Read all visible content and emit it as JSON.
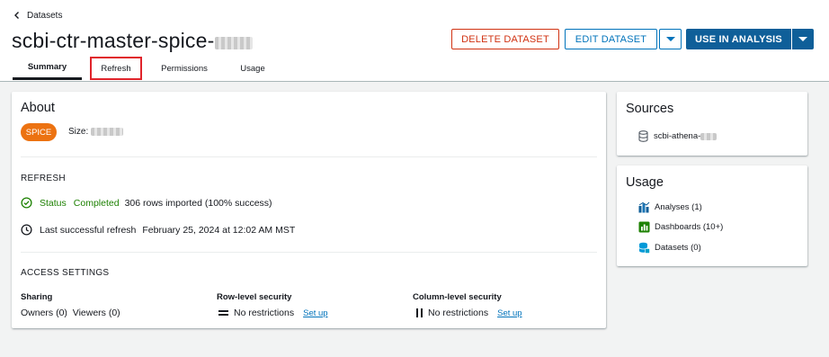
{
  "breadcrumb": {
    "back_label": "Datasets"
  },
  "header": {
    "title": "scbi-ctr-master-spice-",
    "buttons": {
      "delete": "DELETE DATASET",
      "edit": "EDIT DATASET",
      "use": "USE IN ANALYSIS"
    }
  },
  "tabs": [
    {
      "label": "Summary",
      "active": true
    },
    {
      "label": "Refresh",
      "highlighted": true
    },
    {
      "label": "Permissions"
    },
    {
      "label": "Usage"
    }
  ],
  "about": {
    "title": "About",
    "badge": "SPICE",
    "size_label": "Size:"
  },
  "refresh": {
    "heading": "REFRESH",
    "status_label": "Status",
    "status_value": "Completed",
    "rows_imported": "306 rows imported (100% success)",
    "last_refresh_label": "Last successful refresh",
    "last_refresh_value": "February 25, 2024 at 12:02 AM MST"
  },
  "access": {
    "heading": "ACCESS SETTINGS",
    "sharing": {
      "label": "Sharing",
      "value": "Owners (0)  Viewers (0)"
    },
    "row_security": {
      "label": "Row-level security",
      "value": "No restrictions",
      "link": "Set up"
    },
    "col_security": {
      "label": "Column-level security",
      "value": "No restrictions",
      "link": "Set up"
    }
  },
  "sources": {
    "title": "Sources",
    "item": "scbi-athena-"
  },
  "usage": {
    "title": "Usage",
    "items": [
      {
        "label": "Analyses (1)",
        "icon": "analyses-icon"
      },
      {
        "label": "Dashboards (10+)",
        "icon": "dashboards-icon"
      },
      {
        "label": "Datasets (0)",
        "icon": "datasets-icon"
      }
    ]
  },
  "colors": {
    "primary": "#0f5f99",
    "link": "#0073bb",
    "danger": "#d13212",
    "success": "#1d8102",
    "spice_badge": "#ec7211",
    "highlight_box": "#e0242b"
  }
}
